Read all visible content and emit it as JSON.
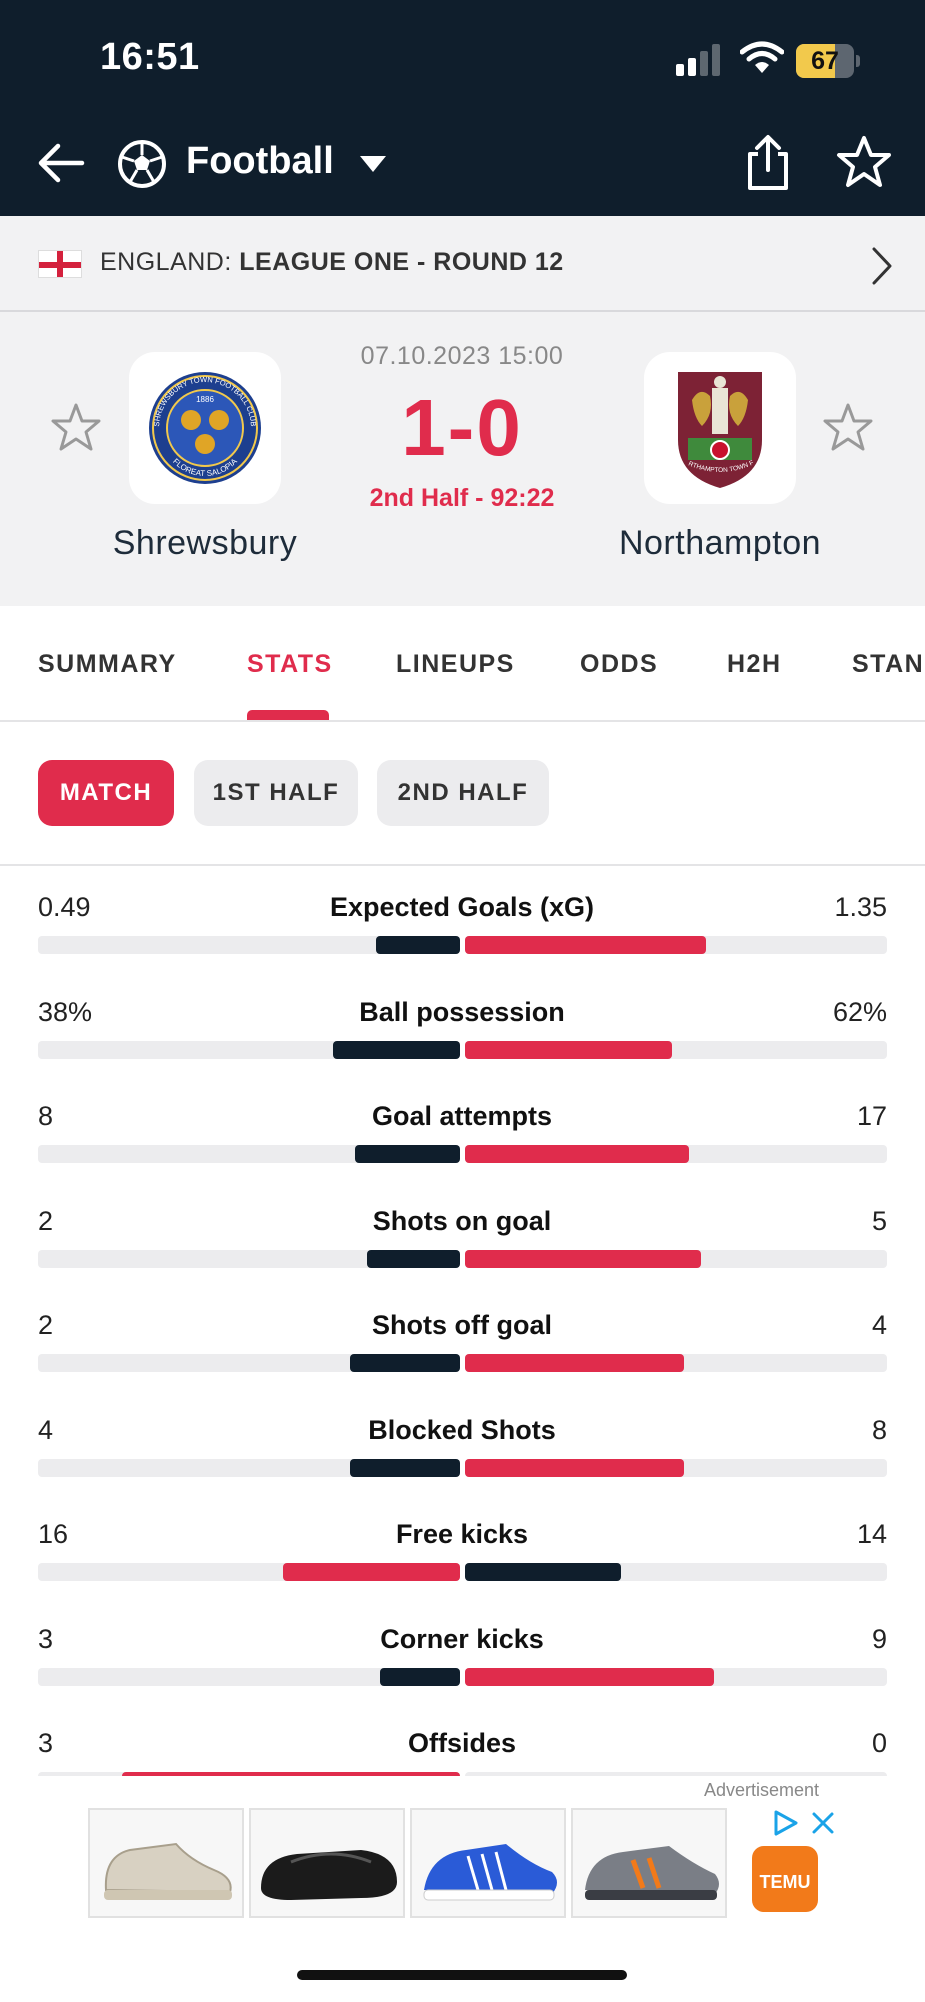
{
  "status_bar": {
    "time": "16:51",
    "battery": "67",
    "battery_level": 0.67
  },
  "app_bar": {
    "sport": "Football",
    "icons": [
      "back-arrow-icon",
      "football-icon",
      "chevron-down-icon",
      "share-icon",
      "star-icon"
    ]
  },
  "league": {
    "country": "ENGLAND:",
    "competition": "LEAGUE ONE - ROUND 12",
    "flag": "england-flag-icon"
  },
  "match": {
    "date": "07.10.2023 15:00",
    "score": "1-0",
    "status": "2nd Half - 92:22",
    "home_team": "Shrewsbury",
    "away_team": "Northampton",
    "home_crest_text": [
      "1886",
      "SHREWSBURY TOWN FOOTBALL CLUB",
      "FLOREAT SALOPIA"
    ],
    "away_crest_text": [
      "NORTHAMPTON TOWN F.C."
    ]
  },
  "tabs": [
    {
      "label": "SUMMARY",
      "active": false
    },
    {
      "label": "STATS",
      "active": true
    },
    {
      "label": "LINEUPS",
      "active": false
    },
    {
      "label": "ODDS",
      "active": false
    },
    {
      "label": "H2H",
      "active": false
    },
    {
      "label": "STAN",
      "active": false
    }
  ],
  "periods": [
    {
      "label": "MATCH",
      "active": true
    },
    {
      "label": "1ST HALF",
      "active": false
    },
    {
      "label": "2ND HALF",
      "active": false
    }
  ],
  "stats": [
    {
      "name": "Expected Goals (xG)",
      "home": "0.49",
      "away": "1.35",
      "home_share": 0.2,
      "away_share": 0.57,
      "leader": "away"
    },
    {
      "name": "Ball possession",
      "home": "38%",
      "away": "62%",
      "home_share": 0.3,
      "away_share": 0.49,
      "leader": "away"
    },
    {
      "name": "Goal attempts",
      "home": "8",
      "away": "17",
      "home_share": 0.25,
      "away_share": 0.53,
      "leader": "away"
    },
    {
      "name": "Shots on goal",
      "home": "2",
      "away": "5",
      "home_share": 0.22,
      "away_share": 0.56,
      "leader": "away"
    },
    {
      "name": "Shots off goal",
      "home": "2",
      "away": "4",
      "home_share": 0.26,
      "away_share": 0.52,
      "leader": "away"
    },
    {
      "name": "Blocked Shots",
      "home": "4",
      "away": "8",
      "home_share": 0.26,
      "away_share": 0.52,
      "leader": "away"
    },
    {
      "name": "Free kicks",
      "home": "16",
      "away": "14",
      "home_share": 0.42,
      "away_share": 0.37,
      "leader": "home"
    },
    {
      "name": "Corner kicks",
      "home": "3",
      "away": "9",
      "home_share": 0.19,
      "away_share": 0.59,
      "leader": "away"
    },
    {
      "name": "Offsides",
      "home": "3",
      "away": "0",
      "home_share": 0.8,
      "away_share": 0.0,
      "leader": "home"
    }
  ],
  "ad": {
    "label": "Advertisement",
    "brand": "TEMU",
    "shoe_colors": [
      "#d8d1c2",
      "#1b1b1b",
      "#2a5bd7",
      "#7a7e86"
    ]
  },
  "colors": {
    "header_bg": "#0f1e2c",
    "accent": "#e02c4c",
    "panel_bg": "#f2f2f3"
  }
}
